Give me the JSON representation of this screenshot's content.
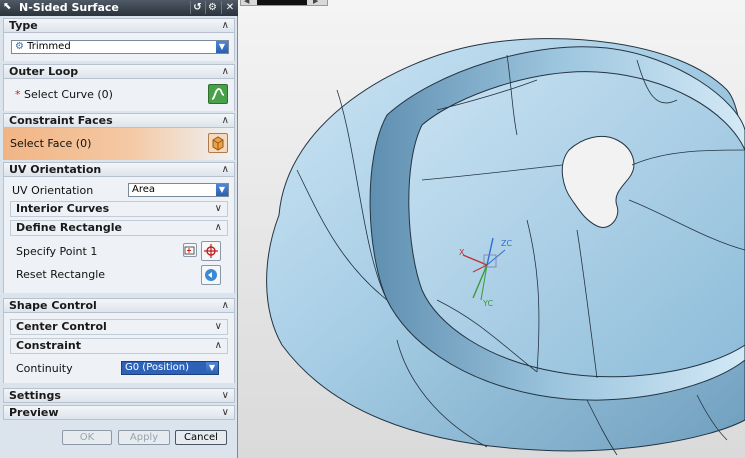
{
  "dialog": {
    "title": "N-Sided Surface",
    "sections": {
      "type": {
        "label": "Type",
        "value": "Trimmed"
      },
      "outer_loop": {
        "label": "Outer Loop",
        "select_curve": "Select Curve (0)"
      },
      "constraint_faces": {
        "label": "Constraint Faces",
        "select_face": "Select Face (0)"
      },
      "uv_orientation": {
        "label": "UV Orientation",
        "field_label": "UV Orientation",
        "value": "Area",
        "interior_curves": "Interior Curves",
        "define_rectangle": "Define Rectangle",
        "specify_point": "Specify Point 1",
        "reset_rectangle": "Reset Rectangle"
      },
      "shape_control": {
        "label": "Shape Control",
        "center_control": "Center Control",
        "constraint": "Constraint",
        "continuity_label": "Continuity",
        "continuity_value": "G0 (Position)"
      },
      "settings": {
        "label": "Settings"
      },
      "preview": {
        "label": "Preview"
      }
    },
    "buttons": {
      "ok": "OK",
      "apply": "Apply",
      "cancel": "Cancel"
    }
  },
  "viewport": {
    "axes": {
      "zc": "ZC",
      "yc": "YC",
      "xc": "X"
    },
    "colors": {
      "surface": "#a9cfe6",
      "edge": "#1f2f3c",
      "zc": "#2b6fd6",
      "yc": "#3a9a3a",
      "x": "#c03030"
    }
  },
  "icons": {
    "title": "nx-tool-icon",
    "reset": "reset-icon",
    "settings": "gear-icon",
    "close": "close-icon",
    "curve": "curve-icon",
    "face": "face-cube-icon",
    "point": "point-icon",
    "reset_rect": "reset-rectangle-icon"
  }
}
